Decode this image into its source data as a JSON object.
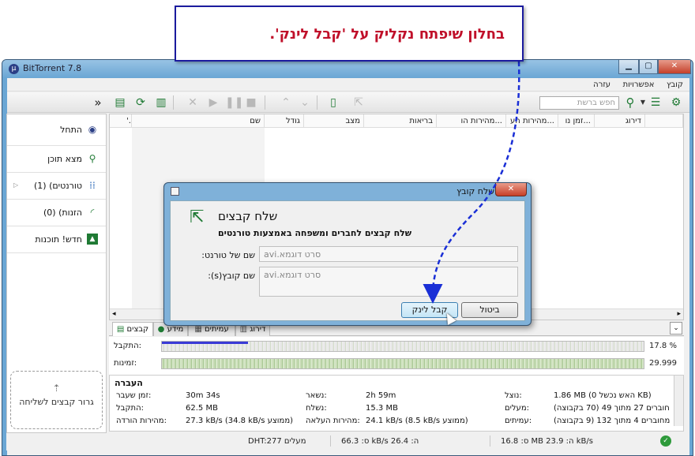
{
  "callout": {
    "text": "בחלון שיפתח נקליק על 'קבל לינק'."
  },
  "window": {
    "title": "BitTorrent 7.8",
    "min": "▁",
    "max": "▢",
    "close": "✕"
  },
  "menu": [
    "קובץ",
    "אפשרויות",
    "עזרה"
  ],
  "toolbar": {
    "collapse": "»",
    "search_placeholder": "חפש ברשת"
  },
  "sidebar": {
    "items": [
      {
        "label": "התחל",
        "icon": "bittorrent-logo-icon"
      },
      {
        "label": "מצא תוכן",
        "icon": "search-icon"
      },
      {
        "label": "טורנטים) (1)",
        "icon": "torrents-icon"
      },
      {
        "label": "הזנות) (0)",
        "icon": "feed-icon"
      },
      {
        "label": "חדש! תוכנות",
        "icon": "apps-icon"
      }
    ],
    "dropzone": {
      "label": "גרור קבצים לשליחה"
    }
  },
  "columns": [
    "שם",
    "גודל",
    "מצב",
    "בריאות",
    "מהירות הו...",
    "מהירות הע...",
    "זמן נו...",
    "דירוג"
  ],
  "tabs": [
    "קבצים",
    "מידע",
    "עמיתים",
    "דירוג"
  ],
  "bars": {
    "received": {
      "label": "התקבל:",
      "value": "17.8 %",
      "fraction": 0.178
    },
    "availability": {
      "label": "זמינות:",
      "value": "29.999"
    }
  },
  "info": {
    "heading": "העברה",
    "rows": [
      [
        {
          "label": "זמן שעבר:",
          "value": "30m 34s"
        },
        {
          "label": "נשאר:",
          "value": "2h 59m"
        },
        {
          "label": "נוצל:",
          "value": "1.86 MB (האש נכשל 0 KB)"
        }
      ],
      [
        {
          "label": "התקבל:",
          "value": "62.5 MB"
        },
        {
          "label": "נשלח:",
          "value": "15.3 MB"
        },
        {
          "label": "מעלים:",
          "value": "חוברים 27 מתוך 49 (70 בקבוצה)"
        }
      ],
      [
        {
          "label": "מהירות הורדה:",
          "value": "27.3 kB/s (34.8 kB/s ממוצע)"
        },
        {
          "label": "מהירות העלאה:",
          "value": "24.1 kB/s (8.5 kB/s ממוצע)"
        },
        {
          "label": "עמיתים:",
          "value": "מחוברים 4 מתוך 132 (9 בקבוצה)"
        }
      ]
    ]
  },
  "status": {
    "dht": "DHT:277 מעלים",
    "down": "ס: 66.3 kB/s ה: 26.4",
    "up": "ס: 16.8 MB ה: 23.9 kB/s"
  },
  "dialog": {
    "title": "שלח קובץ",
    "close": "✕",
    "heading": "שלח קבצים",
    "subheading": "שלח קבצים לחברים ומשפחה באמצעות טורנטים",
    "torrent_name_label": "שם של טורנט:",
    "torrent_name_value": "סרט דוגמא.avi",
    "file_name_label": "שם קובץ(s):",
    "file_name_value": "סרט דוגמא.avi",
    "get_link_button": "קבל לינק",
    "cancel_button": "ביטול"
  },
  "colors": {
    "callout_border": "#1b1b9e",
    "callout_text": "#c0102a",
    "arrow": "#1a2fd6",
    "progress": "#3a3ad6"
  }
}
